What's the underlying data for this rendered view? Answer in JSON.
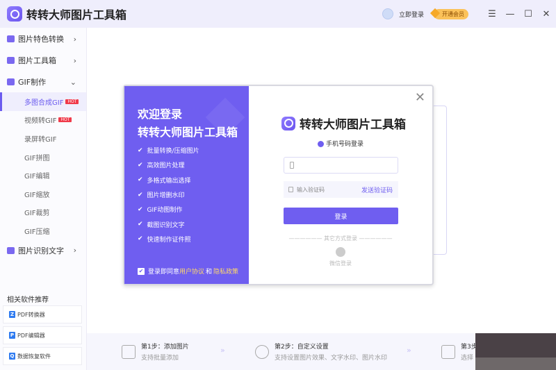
{
  "app": {
    "title": "转转大师图片工具箱",
    "login": "立即登录",
    "vip": "开通会员"
  },
  "sidebar": {
    "sections": [
      {
        "label": "图片特色转换"
      },
      {
        "label": "图片工具箱"
      },
      {
        "label": "GIF制作"
      },
      {
        "label": "图片识别文字"
      }
    ],
    "gif_items": [
      {
        "label": "多图合成GIF",
        "hot": "HOT"
      },
      {
        "label": "视频转GIF",
        "hot": "HOT"
      },
      {
        "label": "录屏转GIF"
      },
      {
        "label": "GIF拼图"
      },
      {
        "label": "GIF编辑"
      },
      {
        "label": "GIF缩放"
      },
      {
        "label": "GIF裁剪"
      },
      {
        "label": "GIF压缩"
      }
    ],
    "related_title": "相关软件推荐",
    "related": [
      "PDF转换器",
      "PDF编辑器",
      "数据恢复软件"
    ]
  },
  "steps": [
    {
      "title": "第1步：添加图片",
      "desc": "支持批量添加"
    },
    {
      "title": "第2步：自定义设置",
      "desc": "支持设置图片效果、文字水印、图片水印"
    },
    {
      "title": "第3步",
      "desc": "选择"
    }
  ],
  "modal": {
    "welcome": "欢迎登录",
    "product": "转转大师图片工具箱",
    "features": [
      "批量转换/压缩图片",
      "高效图片处理",
      "多格式输出选择",
      "图片增删水印",
      "GIF动图制作",
      "截图识别文字",
      "快速制作证件照"
    ],
    "agree_prefix": "登录即同意",
    "agree_user": "用户协议",
    "agree_and": "和",
    "agree_privacy": "隐私政策",
    "title": "转转大师图片工具箱",
    "method": "手机号码登录",
    "phone_placeholder": "",
    "code_placeholder": "输入验证码",
    "send_code": "发送验证码",
    "login_button": "登录",
    "other": "—————— 其它方式登录 ——————",
    "wechat": "微信登录"
  }
}
